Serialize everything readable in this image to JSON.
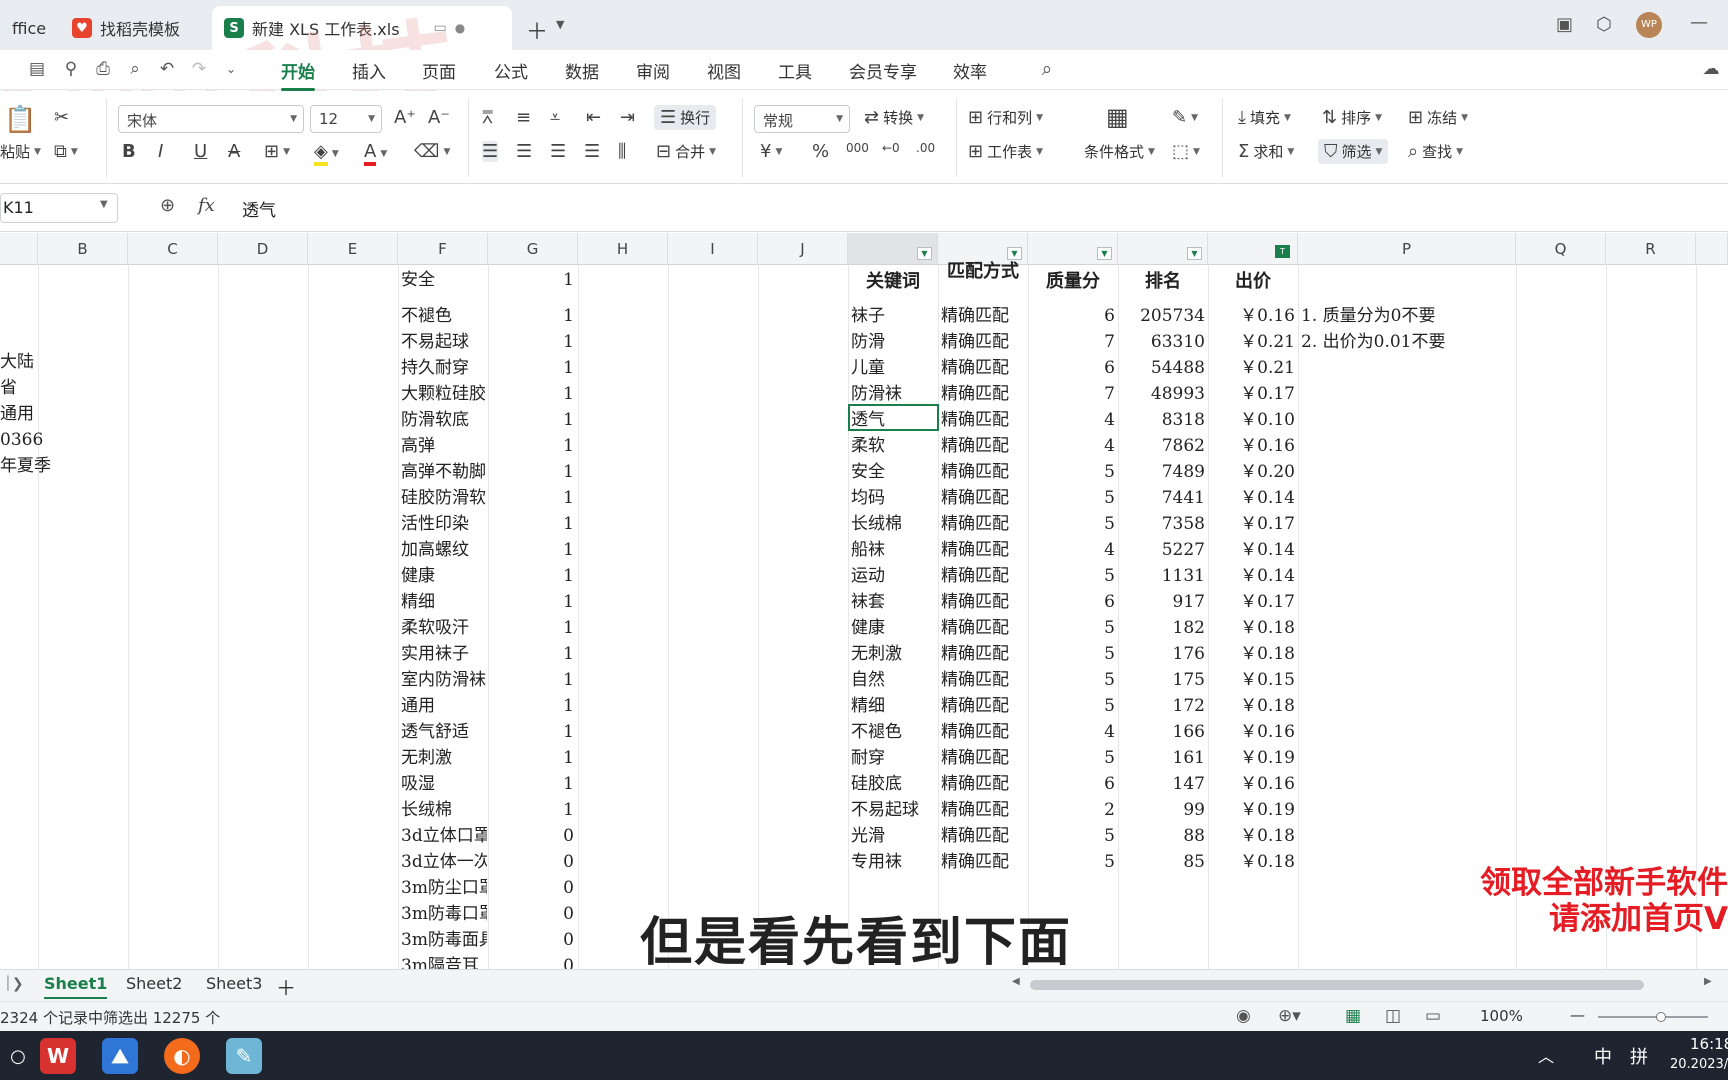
{
  "tabs": [
    {
      "label": "ffice",
      "icon": "wps-office-icon"
    },
    {
      "label": "找稻壳模板",
      "icon": "docer-icon"
    },
    {
      "label": "新建 XLS 工作表.xls",
      "icon": "spreadsheet-icon"
    }
  ],
  "user_initials": "WP",
  "menu": [
    "开始",
    "插入",
    "页面",
    "公式",
    "数据",
    "审阅",
    "视图",
    "工具",
    "会员专享",
    "效率"
  ],
  "ribbon": {
    "paste": "粘贴",
    "font_name": "宋体",
    "font_size": "12",
    "wrap": "换行",
    "merge": "合并",
    "number_format": "常规",
    "convert": "转换",
    "row_col": "行和列",
    "worksheet": "工作表",
    "cond_format": "条件格式",
    "fill": "填充",
    "sort": "排序",
    "freeze": "冻结",
    "sum": "求和",
    "filter": "筛选",
    "find": "查找",
    "bold": "B",
    "italic": "I",
    "underline": "U",
    "strike": "A",
    "currency": "¥",
    "percent": "%",
    "thousands": "000"
  },
  "formula_bar": {
    "name_box": "K11",
    "fx": "fx",
    "content": "透气"
  },
  "columns": [
    "B",
    "C",
    "D",
    "E",
    "F",
    "G",
    "H",
    "I",
    "J",
    "",
    "",
    "",
    "",
    "",
    "P",
    "Q",
    "R"
  ],
  "col_a_values": [
    "",
    "",
    "大陆",
    "省",
    "通用",
    "0366",
    "年夏季"
  ],
  "f_rows": [
    [
      "安全",
      "1"
    ],
    [
      "不褪色",
      "1"
    ],
    [
      "不易起球",
      "1"
    ],
    [
      "持久耐穿",
      "1"
    ],
    [
      "大颗粒硅胶",
      "1"
    ],
    [
      "防滑软底",
      "1"
    ],
    [
      "高弹",
      "1"
    ],
    [
      "高弹不勒脚",
      "1"
    ],
    [
      "硅胶防滑软",
      "1"
    ],
    [
      "活性印染",
      "1"
    ],
    [
      "加高螺纹",
      "1"
    ],
    [
      "健康",
      "1"
    ],
    [
      "精细",
      "1"
    ],
    [
      "柔软吸汗",
      "1"
    ],
    [
      "实用袜子",
      "1"
    ],
    [
      "室内防滑袜",
      "1"
    ],
    [
      "通用",
      "1"
    ],
    [
      "透气舒适",
      "1"
    ],
    [
      "无刺激",
      "1"
    ],
    [
      "吸湿",
      "1"
    ],
    [
      "长绒棉",
      "1"
    ],
    [
      "3d立体口罩",
      "0"
    ],
    [
      "3d立体一次",
      "0"
    ],
    [
      "3m防尘口罩",
      "0"
    ],
    [
      "3m防毒口罩",
      "0"
    ],
    [
      "3m防毒面具",
      "0"
    ],
    [
      "3m隔音耳",
      "0"
    ]
  ],
  "table_headers": [
    "关键词",
    "匹配方式",
    "质量分",
    "排名",
    "出价"
  ],
  "table_rows": [
    [
      "袜子",
      "精确匹配",
      "6",
      "205734",
      "￥0.16"
    ],
    [
      "防滑",
      "精确匹配",
      "7",
      "63310",
      "￥0.21"
    ],
    [
      "儿童",
      "精确匹配",
      "6",
      "54488",
      "￥0.21"
    ],
    [
      "防滑袜",
      "精确匹配",
      "7",
      "48993",
      "￥0.17"
    ],
    [
      "透气",
      "精确匹配",
      "4",
      "8318",
      "￥0.10"
    ],
    [
      "柔软",
      "精确匹配",
      "4",
      "7862",
      "￥0.16"
    ],
    [
      "安全",
      "精确匹配",
      "5",
      "7489",
      "￥0.20"
    ],
    [
      "均码",
      "精确匹配",
      "5",
      "7441",
      "￥0.14"
    ],
    [
      "长绒棉",
      "精确匹配",
      "5",
      "7358",
      "￥0.17"
    ],
    [
      "船袜",
      "精确匹配",
      "4",
      "5227",
      "￥0.14"
    ],
    [
      "运动",
      "精确匹配",
      "5",
      "1131",
      "￥0.14"
    ],
    [
      "袜套",
      "精确匹配",
      "6",
      "917",
      "￥0.17"
    ],
    [
      "健康",
      "精确匹配",
      "5",
      "182",
      "￥0.18"
    ],
    [
      "无刺激",
      "精确匹配",
      "5",
      "176",
      "￥0.18"
    ],
    [
      "自然",
      "精确匹配",
      "5",
      "175",
      "￥0.15"
    ],
    [
      "精细",
      "精确匹配",
      "5",
      "172",
      "￥0.18"
    ],
    [
      "不褪色",
      "精确匹配",
      "4",
      "166",
      "￥0.16"
    ],
    [
      "耐穿",
      "精确匹配",
      "5",
      "161",
      "￥0.19"
    ],
    [
      "硅胶底",
      "精确匹配",
      "6",
      "147",
      "￥0.16"
    ],
    [
      "不易起球",
      "精确匹配",
      "2",
      "99",
      "￥0.19"
    ],
    [
      "光滑",
      "精确匹配",
      "5",
      "88",
      "￥0.18"
    ],
    [
      "专用袜",
      "精确匹配",
      "5",
      "85",
      "￥0.18"
    ]
  ],
  "notes": [
    "1. 质量分为0不要",
    "2. 出价为0.01不要"
  ],
  "subtitle": "但是看先看到下面",
  "promo": [
    "领取全部新手软件",
    "请添加首页V"
  ],
  "watermark": "秋知科技",
  "sheets": [
    "Sheet1",
    "Sheet2",
    "Sheet3"
  ],
  "status": {
    "records": "2324 个记录中筛选出 12275 个",
    "zoom": "100%"
  },
  "taskbar": {
    "time": "16:18",
    "date": "20.2023/",
    "ime1": "中",
    "ime2": "拼"
  },
  "colors": {
    "accent": "#1a7f4b",
    "promo": "#e51c23"
  }
}
